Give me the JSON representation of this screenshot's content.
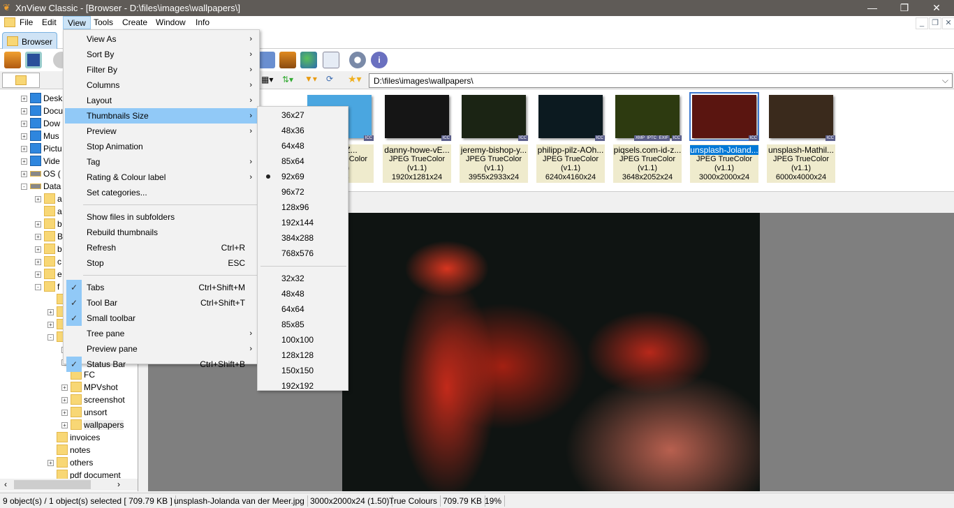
{
  "window": {
    "title": "XnView Classic - [Browser - D:\\files\\images\\wallpapers\\]"
  },
  "menubar": [
    "File",
    "Edit",
    "View",
    "Tools",
    "Create",
    "Window",
    "Info"
  ],
  "tabs": [
    {
      "label": "Browser"
    }
  ],
  "address": {
    "value": "D:\\files\\images\\wallpapers\\"
  },
  "tree": [
    {
      "label": "Desk",
      "depth": 0,
      "pm": "+",
      "icon": "desktop"
    },
    {
      "label": "Docu",
      "depth": 0,
      "pm": "+",
      "icon": "documents"
    },
    {
      "label": "Dow",
      "depth": 0,
      "pm": "+",
      "icon": "downloads"
    },
    {
      "label": "Mus",
      "depth": 0,
      "pm": "+",
      "icon": "music"
    },
    {
      "label": "Pictu",
      "depth": 0,
      "pm": "+",
      "icon": "pictures"
    },
    {
      "label": "Vide",
      "depth": 0,
      "pm": "+",
      "icon": "videos"
    },
    {
      "label": "OS (",
      "depth": 0,
      "pm": "+",
      "icon": "drive"
    },
    {
      "label": "Data",
      "depth": 0,
      "pm": "-",
      "icon": "drive"
    },
    {
      "label": "a",
      "depth": 1,
      "pm": "+"
    },
    {
      "label": "a",
      "depth": 1,
      "pm": ""
    },
    {
      "label": "b",
      "depth": 1,
      "pm": "+"
    },
    {
      "label": "B",
      "depth": 1,
      "pm": "+"
    },
    {
      "label": "b",
      "depth": 1,
      "pm": "+"
    },
    {
      "label": "c",
      "depth": 1,
      "pm": "+"
    },
    {
      "label": "e",
      "depth": 1,
      "pm": "+"
    },
    {
      "label": "f",
      "depth": 1,
      "pm": "-"
    },
    {
      "label": "",
      "depth": 2,
      "pm": ""
    },
    {
      "label": "",
      "depth": 2,
      "pm": "+"
    },
    {
      "label": "",
      "depth": 2,
      "pm": "+"
    },
    {
      "label": "",
      "depth": 2,
      "pm": "-"
    },
    {
      "label": "",
      "depth": 3,
      "pm": "-"
    },
    {
      "label": "",
      "depth": 3,
      "pm": "-"
    },
    {
      "label": "FC",
      "depth": 3,
      "pm": ""
    },
    {
      "label": "MPVshot",
      "depth": 3,
      "pm": "+"
    },
    {
      "label": "screenshot",
      "depth": 3,
      "pm": "+"
    },
    {
      "label": "unsort",
      "depth": 3,
      "pm": "+"
    },
    {
      "label": "wallpapers",
      "depth": 3,
      "pm": "+"
    },
    {
      "label": "invoices",
      "depth": 2,
      "pm": ""
    },
    {
      "label": "notes",
      "depth": 2,
      "pm": ""
    },
    {
      "label": "others",
      "depth": 2,
      "pm": "+"
    },
    {
      "label": "pdf document",
      "depth": 2,
      "pm": ""
    }
  ],
  "thumbnails": [
    {
      "name": "...ariu-Z...",
      "format": "JPEG TrueColor (v1.1)",
      "dims": "...x24",
      "badges": [
        "ICC"
      ],
      "color": "#4aa6e0",
      "selected": false
    },
    {
      "name": "danny-howe-vE...",
      "format": "JPEG TrueColor (v1.1)",
      "dims": "1920x1281x24",
      "badges": [
        "ICC"
      ],
      "color": "#151515",
      "selected": false
    },
    {
      "name": "jeremy-bishop-y...",
      "format": "JPEG TrueColor (v1.1)",
      "dims": "3955x2933x24",
      "badges": [
        "ICC"
      ],
      "color": "#1b2414",
      "selected": false
    },
    {
      "name": "philipp-pilz-AOh...",
      "format": "JPEG TrueColor (v1.1)",
      "dims": "6240x4160x24",
      "badges": [
        "ICC"
      ],
      "color": "#0c1a20",
      "selected": false
    },
    {
      "name": "piqsels.com-id-z...",
      "format": "JPEG TrueColor (v1.1)",
      "dims": "3648x2052x24",
      "badges": [
        "XMP",
        "IPTC",
        "EXIF",
        "ICC"
      ],
      "color": "#2d3a10",
      "selected": false
    },
    {
      "name": "unsplash-Joland...",
      "format": "JPEG TrueColor (v1.1)",
      "dims": "3000x2000x24",
      "badges": [
        "ICC"
      ],
      "color": "#5a1510",
      "selected": true
    },
    {
      "name": "unsplash-Mathil...",
      "format": "JPEG TrueColor (v1.1)",
      "dims": "6000x4000x24",
      "badges": [
        "ICC"
      ],
      "color": "#3a2a1c",
      "selected": false
    }
  ],
  "view_menu": [
    {
      "label": "View As",
      "submenu": true
    },
    {
      "label": "Sort By",
      "submenu": true
    },
    {
      "label": "Filter By",
      "submenu": true
    },
    {
      "label": "Columns",
      "submenu": true
    },
    {
      "label": "Layout",
      "submenu": true
    },
    {
      "label": "Thumbnails Size",
      "submenu": true,
      "highlighted": true
    },
    {
      "label": "Preview",
      "submenu": true
    },
    {
      "label": "Stop Animation"
    },
    {
      "label": "Tag",
      "submenu": true
    },
    {
      "label": "Rating & Colour label",
      "submenu": true
    },
    {
      "label": "Set categories..."
    },
    {
      "separator": true
    },
    {
      "label": "Show files in subfolders"
    },
    {
      "label": "Rebuild thumbnails"
    },
    {
      "label": "Refresh",
      "shortcut": "Ctrl+R"
    },
    {
      "label": "Stop",
      "shortcut": "ESC"
    },
    {
      "separator": true
    },
    {
      "label": "Tabs",
      "shortcut": "Ctrl+Shift+M",
      "checked": true
    },
    {
      "label": "Tool Bar",
      "shortcut": "Ctrl+Shift+T",
      "checked": true
    },
    {
      "label": "Small toolbar",
      "checked": true
    },
    {
      "label": "Tree pane",
      "submenu": true
    },
    {
      "label": "Preview pane",
      "submenu": true
    },
    {
      "label": "Status Bar",
      "shortcut": "Ctrl+Shift+B",
      "checked": true
    }
  ],
  "thumb_size_menu": [
    {
      "label": "36x27"
    },
    {
      "label": "48x36"
    },
    {
      "label": "64x48"
    },
    {
      "label": "85x64"
    },
    {
      "label": "92x69",
      "selected": true
    },
    {
      "label": "96x72"
    },
    {
      "label": "128x96"
    },
    {
      "label": "192x144"
    },
    {
      "label": "384x288"
    },
    {
      "label": "768x576"
    },
    {
      "separator": true
    },
    {
      "label": "32x32"
    },
    {
      "label": "48x48"
    },
    {
      "label": "64x64"
    },
    {
      "label": "85x85"
    },
    {
      "label": "100x100"
    },
    {
      "label": "128x128"
    },
    {
      "label": "150x150"
    },
    {
      "label": "192x192"
    }
  ],
  "status": [
    "9 object(s) / 1 object(s) selected  [ 709.79 KB ]",
    "unsplash-Jolanda van der Meer.jpg",
    "3000x2000x24 (1.50)",
    "True Colours",
    "709.79 KB",
    "19%"
  ],
  "colors": {
    "titlebar": "#5f5b57",
    "highlight": "#91c9f7",
    "selection": "#0078d7",
    "thumb_label": "#efebcd"
  }
}
